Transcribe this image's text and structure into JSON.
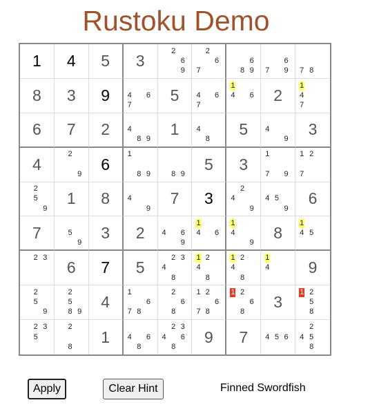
{
  "title": "Rustoku Demo",
  "buttons": {
    "apply": "Apply",
    "clear_hint": "Clear Hint"
  },
  "hint_name": "Finned Swordfish",
  "colors": {
    "title": "#a0522d",
    "highlight_yellow": "#ffff66",
    "highlight_red": "#e8391f"
  },
  "grid": [
    [
      {
        "v": "1",
        "t": "given"
      },
      {
        "v": "4",
        "t": "given"
      },
      {
        "v": "5",
        "t": "value"
      },
      {
        "v": "3",
        "t": "value"
      },
      {
        "c": [
          "",
          "2",
          "",
          "",
          "",
          "6",
          "",
          "",
          "9"
        ]
      },
      {
        "c": [
          "",
          "2",
          "",
          "",
          "",
          "6",
          "7",
          "",
          ""
        ]
      },
      {
        "c": [
          "",
          "",
          "",
          "",
          "",
          "6",
          "",
          "8",
          "9"
        ]
      },
      {
        "c": [
          "",
          "",
          "",
          "",
          "",
          "6",
          "7",
          "",
          "9"
        ]
      },
      {
        "c": [
          "",
          "",
          "",
          "",
          "",
          "",
          "7",
          "8",
          ""
        ]
      }
    ],
    [
      {
        "v": "8",
        "t": "value"
      },
      {
        "v": "3",
        "t": "value"
      },
      {
        "v": "9",
        "t": "given"
      },
      {
        "c": [
          "",
          "",
          "",
          "4",
          "",
          "6",
          "7",
          "",
          ""
        ]
      },
      {
        "v": "5",
        "t": "value"
      },
      {
        "c": [
          "",
          "",
          "",
          "4",
          "",
          "6",
          "7",
          "",
          ""
        ]
      },
      {
        "c": [
          "1",
          "",
          "",
          "4",
          "",
          "6",
          "",
          "",
          ""
        ],
        "h": {
          "0": "y"
        }
      },
      {
        "v": "2",
        "t": "value"
      },
      {
        "c": [
          "1",
          "",
          "",
          "4",
          "",
          "",
          "7",
          "",
          ""
        ],
        "h": {
          "0": "y"
        }
      }
    ],
    [
      {
        "v": "6",
        "t": "value"
      },
      {
        "v": "7",
        "t": "value"
      },
      {
        "v": "2",
        "t": "value"
      },
      {
        "c": [
          "",
          "",
          "",
          "4",
          "",
          "",
          "",
          "8",
          "9"
        ]
      },
      {
        "v": "1",
        "t": "value"
      },
      {
        "c": [
          "",
          "",
          "",
          "4",
          "",
          "",
          "",
          "8",
          ""
        ]
      },
      {
        "v": "5",
        "t": "value"
      },
      {
        "c": [
          "",
          "",
          "",
          "4",
          "",
          "",
          "",
          "",
          "9"
        ]
      },
      {
        "v": "3",
        "t": "value"
      }
    ],
    [
      {
        "v": "4",
        "t": "value"
      },
      {
        "c": [
          "",
          "2",
          "",
          "",
          "",
          "",
          "",
          "",
          "9"
        ]
      },
      {
        "v": "6",
        "t": "given"
      },
      {
        "c": [
          "1",
          "",
          "",
          "",
          "",
          "",
          "",
          "8",
          "9"
        ]
      },
      {
        "c": [
          "",
          "",
          "",
          "",
          "",
          "",
          "",
          "8",
          "9"
        ]
      },
      {
        "v": "5",
        "t": "value"
      },
      {
        "v": "3",
        "t": "value"
      },
      {
        "c": [
          "1",
          "",
          "",
          "",
          "",
          "",
          "7",
          "",
          "9"
        ]
      },
      {
        "c": [
          "1",
          "2",
          "",
          "",
          "",
          "",
          "7",
          "",
          ""
        ]
      }
    ],
    [
      {
        "c": [
          "",
          "2",
          "",
          "",
          "5",
          "",
          "",
          "",
          "9"
        ]
      },
      {
        "v": "1",
        "t": "value"
      },
      {
        "v": "8",
        "t": "value"
      },
      {
        "c": [
          "",
          "",
          "",
          "4",
          "",
          "",
          "",
          "",
          "9"
        ]
      },
      {
        "v": "7",
        "t": "value"
      },
      {
        "v": "3",
        "t": "given"
      },
      {
        "c": [
          "",
          "2",
          "",
          "4",
          "",
          "",
          "",
          "",
          "9"
        ]
      },
      {
        "c": [
          "",
          "",
          "",
          "4",
          "5",
          "",
          "",
          "",
          "9"
        ]
      },
      {
        "v": "6",
        "t": "value"
      }
    ],
    [
      {
        "v": "7",
        "t": "value"
      },
      {
        "c": [
          "",
          "",
          "",
          "",
          "5",
          "",
          "",
          "",
          "9"
        ]
      },
      {
        "v": "3",
        "t": "value"
      },
      {
        "v": "2",
        "t": "value"
      },
      {
        "c": [
          "",
          "",
          "",
          "4",
          "",
          "6",
          "",
          "",
          "9"
        ]
      },
      {
        "c": [
          "1",
          "",
          "",
          "4",
          "",
          "6",
          "",
          "",
          ""
        ],
        "h": {
          "0": "y"
        }
      },
      {
        "c": [
          "1",
          "",
          "",
          "4",
          "",
          "",
          "",
          "",
          "9"
        ],
        "h": {
          "0": "y"
        }
      },
      {
        "v": "8",
        "t": "value"
      },
      {
        "c": [
          "1",
          "",
          "",
          "4",
          "5",
          "",
          "",
          "",
          ""
        ],
        "h": {
          "0": "y"
        }
      }
    ],
    [
      {
        "c": [
          "",
          "2",
          "3",
          "",
          "",
          "",
          "",
          "",
          ""
        ]
      },
      {
        "v": "6",
        "t": "value"
      },
      {
        "v": "7",
        "t": "given"
      },
      {
        "v": "5",
        "t": "value"
      },
      {
        "c": [
          "",
          "2",
          "3",
          "4",
          "",
          "",
          "",
          "8",
          ""
        ]
      },
      {
        "c": [
          "1",
          "2",
          "",
          "4",
          "",
          "",
          "",
          "8",
          ""
        ],
        "h": {
          "0": "y"
        }
      },
      {
        "c": [
          "1",
          "2",
          "",
          "4",
          "",
          "",
          "",
          "8",
          ""
        ],
        "h": {
          "0": "y"
        }
      },
      {
        "c": [
          "1",
          "",
          "",
          "4",
          "",
          "",
          "",
          "",
          ""
        ],
        "h": {
          "0": "y"
        }
      },
      {
        "v": "9",
        "t": "value"
      }
    ],
    [
      {
        "c": [
          "",
          "2",
          "",
          "",
          "5",
          "",
          "",
          "",
          "9"
        ]
      },
      {
        "c": [
          "",
          "2",
          "",
          "",
          "5",
          "",
          "",
          "8",
          "9"
        ]
      },
      {
        "v": "4",
        "t": "value"
      },
      {
        "c": [
          "1",
          "",
          "",
          "",
          "",
          "6",
          "7",
          "8",
          ""
        ]
      },
      {
        "c": [
          "",
          "2",
          "",
          "",
          "",
          "6",
          "",
          "8",
          ""
        ]
      },
      {
        "c": [
          "1",
          "2",
          "",
          "",
          "",
          "6",
          "7",
          "8",
          ""
        ]
      },
      {
        "c": [
          "1",
          "2",
          "",
          "",
          "",
          "6",
          "",
          "8",
          ""
        ],
        "h": {
          "0": "r"
        }
      },
      {
        "v": "3",
        "t": "value"
      },
      {
        "c": [
          "1",
          "2",
          "",
          "",
          "5",
          "",
          "",
          "8",
          ""
        ],
        "h": {
          "0": "r"
        }
      }
    ],
    [
      {
        "c": [
          "",
          "2",
          "3",
          "",
          "5",
          "",
          "",
          "",
          ""
        ]
      },
      {
        "c": [
          "",
          "2",
          "",
          "",
          "",
          "",
          "",
          "8",
          ""
        ]
      },
      {
        "v": "1",
        "t": "value"
      },
      {
        "c": [
          "",
          "",
          "",
          "4",
          "",
          "6",
          "",
          "8",
          ""
        ]
      },
      {
        "c": [
          "",
          "2",
          "3",
          "4",
          "",
          "6",
          "",
          "8",
          ""
        ]
      },
      {
        "v": "9",
        "t": "value"
      },
      {
        "v": "7",
        "t": "value"
      },
      {
        "c": [
          "",
          "",
          "",
          "4",
          "5",
          "6",
          "",
          "",
          ""
        ]
      },
      {
        "c": [
          "",
          "2",
          "",
          "4",
          "5",
          "",
          "",
          "8",
          ""
        ]
      }
    ]
  ]
}
